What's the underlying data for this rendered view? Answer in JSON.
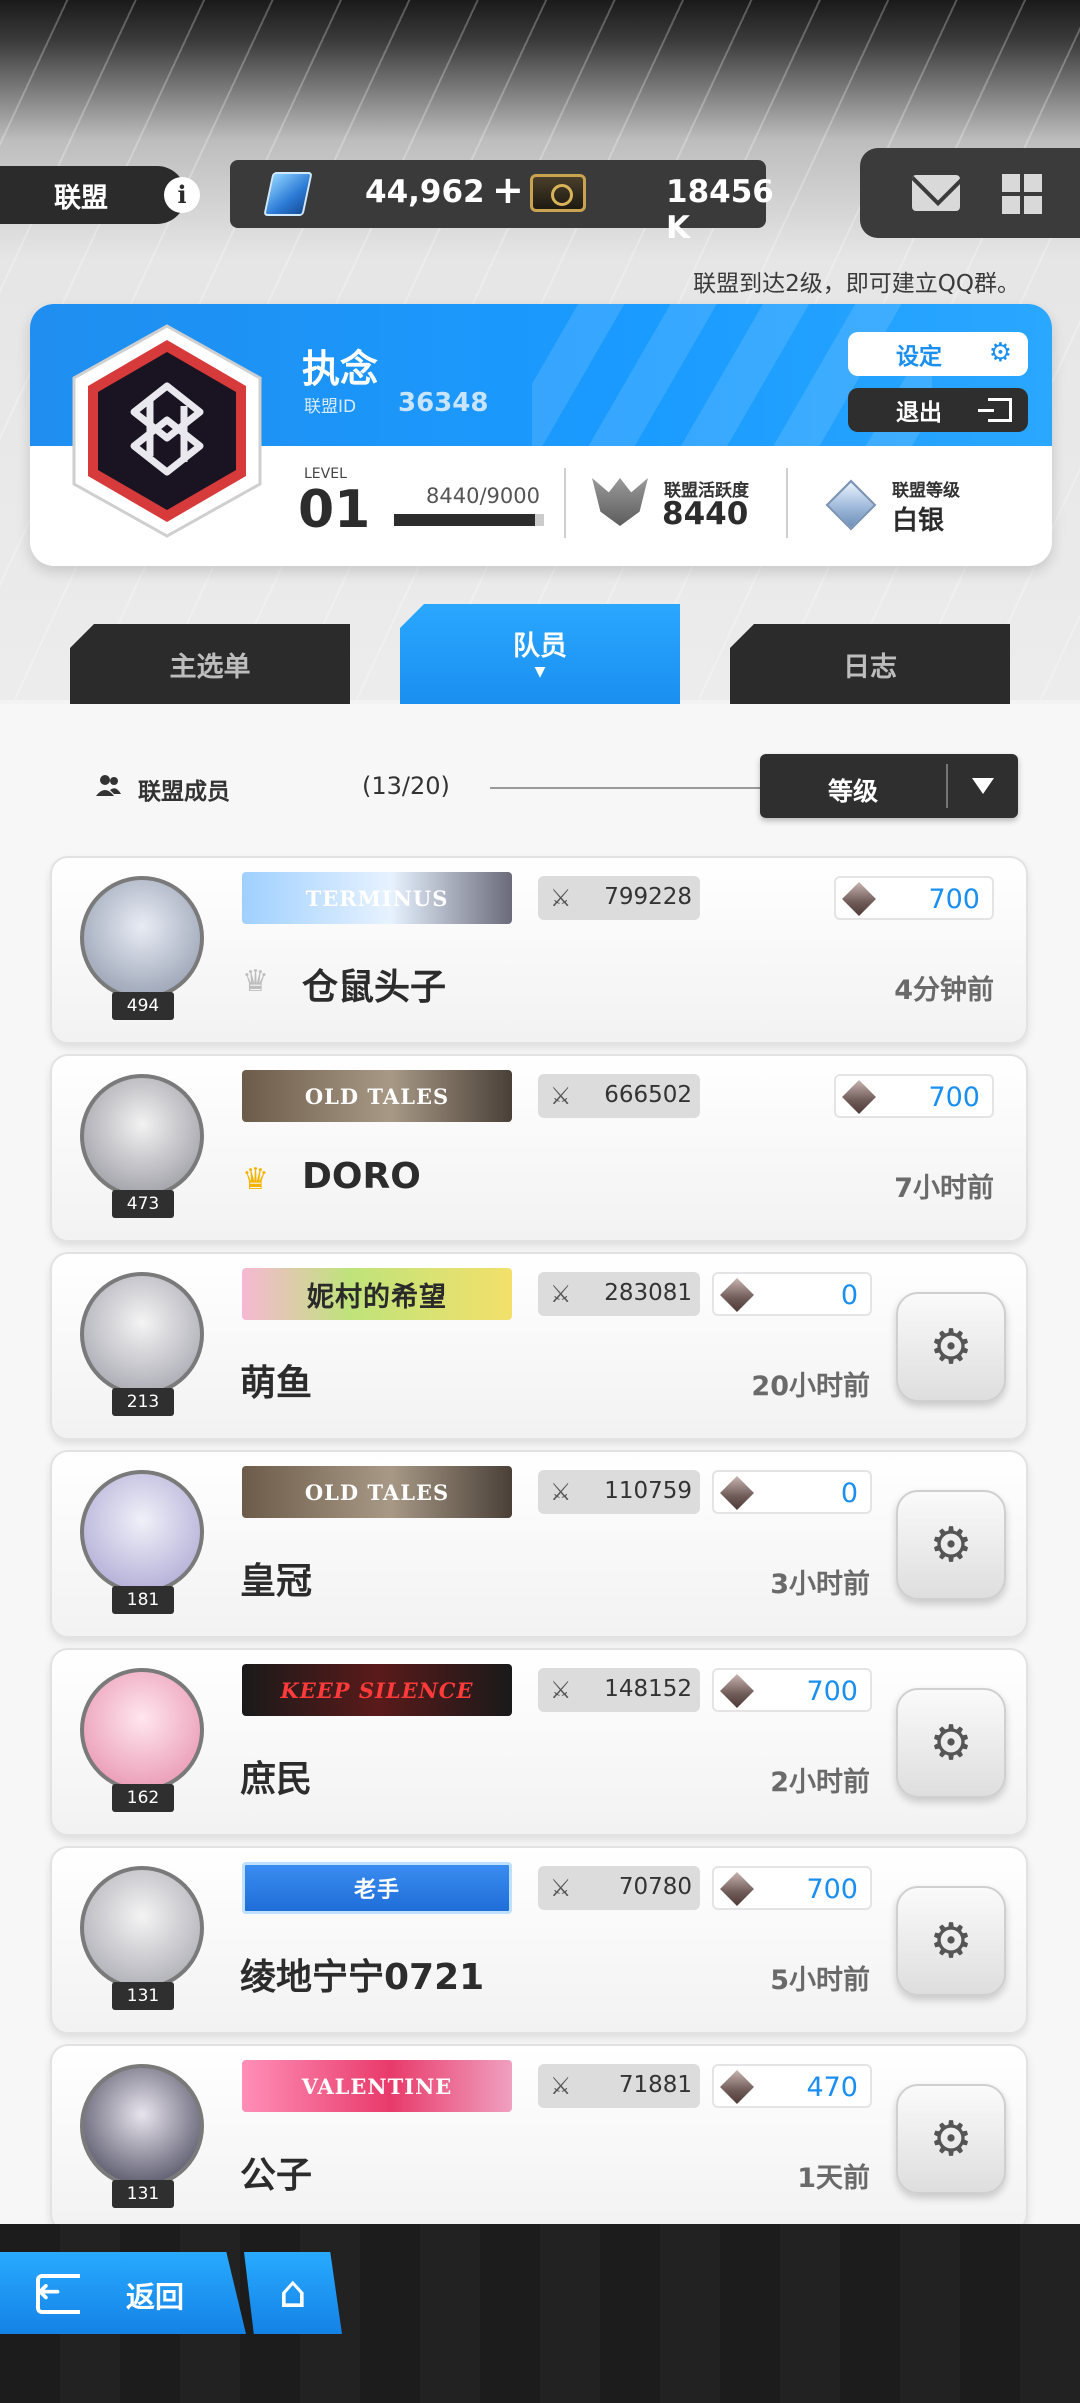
{
  "header": {
    "alliance_tab": "联盟",
    "gems": "44,962",
    "plus": "+",
    "credits": "18456 K",
    "hint": "联盟到达2级，即可建立QQ群。"
  },
  "card": {
    "name": "执念",
    "id_label": "联盟ID",
    "id": "36348",
    "setting_label": "设定",
    "exit_label": "退出",
    "level_label": "LEVEL",
    "level": "01",
    "exp_text": "8440/9000",
    "exp_progress": 0.9378,
    "activity_label": "联盟活跃度",
    "activity_value": "8440",
    "rank_label": "联盟等级",
    "rank_value": "白银"
  },
  "tabs": {
    "main_menu": "主选单",
    "members": "队员",
    "log": "日志"
  },
  "list": {
    "members_label": "联盟成员",
    "count": "(13/20)",
    "sort": "等级",
    "members": [
      {
        "name": "仓鼠头子",
        "level": "494",
        "banner": "TERMINUS",
        "power": "799228",
        "contribution": "700",
        "last_seen": "4分钟前",
        "crown": "silver"
      },
      {
        "name": "DORO",
        "level": "473",
        "banner": "OLD TALES",
        "power": "666502",
        "contribution": "700",
        "last_seen": "7小时前",
        "crown": "gold"
      },
      {
        "name": "萌鱼",
        "level": "213",
        "banner": "妮村的希望",
        "power": "283081",
        "contribution": "0",
        "last_seen": "20小时前"
      },
      {
        "name": "皇冠",
        "level": "181",
        "banner": "OLD TALES",
        "power": "110759",
        "contribution": "0",
        "last_seen": "3小时前"
      },
      {
        "name": "庶民",
        "level": "162",
        "banner": "KEEP SILENCE",
        "power": "148152",
        "contribution": "700",
        "last_seen": "2小时前"
      },
      {
        "name": "绫地宁宁0721",
        "level": "131",
        "banner": "老手",
        "power": "70780",
        "contribution": "700",
        "last_seen": "5小时前"
      },
      {
        "name": "公子",
        "level": "131",
        "banner": "VALENTINE",
        "power": "71881",
        "contribution": "470",
        "last_seen": "1天前"
      }
    ]
  },
  "footer": {
    "back_label": "返回"
  },
  "colors": {
    "accent": "#1a8ff0",
    "dark": "#2b2b2b"
  }
}
